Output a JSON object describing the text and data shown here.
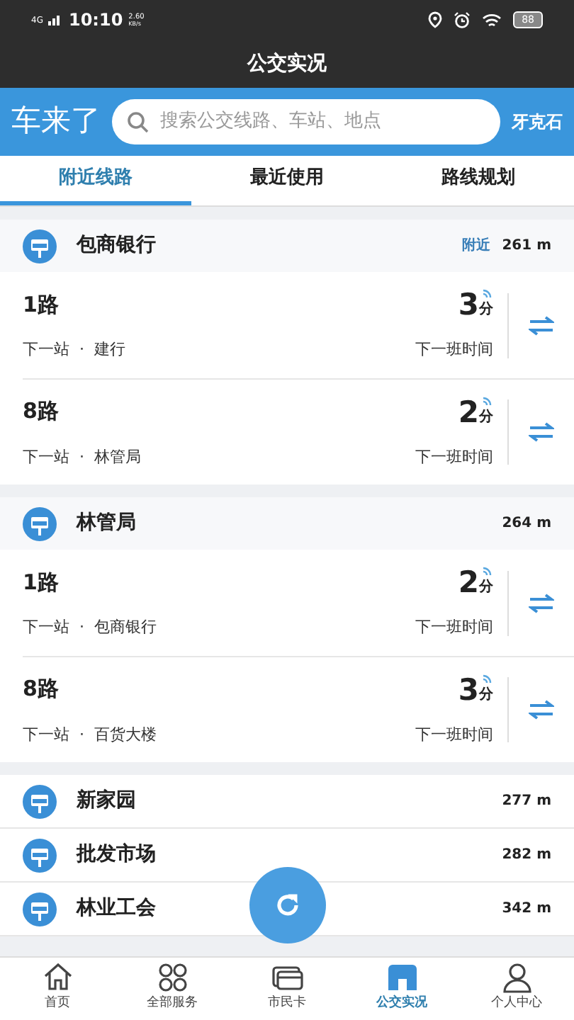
{
  "status_bar": {
    "network": "4G",
    "time": "10:10",
    "speed": "2.60",
    "speed_unit": "KB/s",
    "battery": "88"
  },
  "title": "公交实况",
  "header": {
    "logo": "车来了",
    "search": {
      "placeholder": "搜索公交线路、车站、地点"
    },
    "city": "牙克石"
  },
  "tabs": [
    {
      "label": "附近线路",
      "selected": true
    },
    {
      "label": "最近使用",
      "selected": false
    },
    {
      "label": "路线规划",
      "selected": false
    }
  ],
  "stations": [
    {
      "name": "包商银行",
      "tag": "附近",
      "distance": "261 m",
      "lines": [
        {
          "name": "1路",
          "next_label": "下一站",
          "separator": "·",
          "next_stop": "建行",
          "minutes": "3",
          "unit": "分",
          "caption": "下一班时间"
        },
        {
          "name": "8路",
          "next_label": "下一站",
          "separator": "·",
          "next_stop": "林管局",
          "minutes": "2",
          "unit": "分",
          "caption": "下一班时间"
        }
      ]
    },
    {
      "name": "林管局",
      "distance": "264 m",
      "lines": [
        {
          "name": "1路",
          "next_label": "下一站",
          "separator": "·",
          "next_stop": "包商银行",
          "minutes": "2",
          "unit": "分",
          "caption": "下一班时间"
        },
        {
          "name": "8路",
          "next_label": "下一站",
          "separator": "·",
          "next_stop": "百货大楼",
          "minutes": "3",
          "unit": "分",
          "caption": "下一班时间"
        }
      ]
    },
    {
      "name": "新家园",
      "distance": "277 m"
    },
    {
      "name": "批发市场",
      "distance": "282 m"
    },
    {
      "name": "林业工会",
      "distance": "342 m"
    }
  ],
  "bottom_nav": [
    {
      "label": "首页",
      "kind": "home",
      "selected": false
    },
    {
      "label": "全部服务",
      "kind": "grid",
      "selected": false
    },
    {
      "label": "市民卡",
      "kind": "card",
      "selected": false
    },
    {
      "label": "公交实况",
      "kind": "bus",
      "selected": true
    },
    {
      "label": "个人中心",
      "kind": "person",
      "selected": false
    }
  ]
}
